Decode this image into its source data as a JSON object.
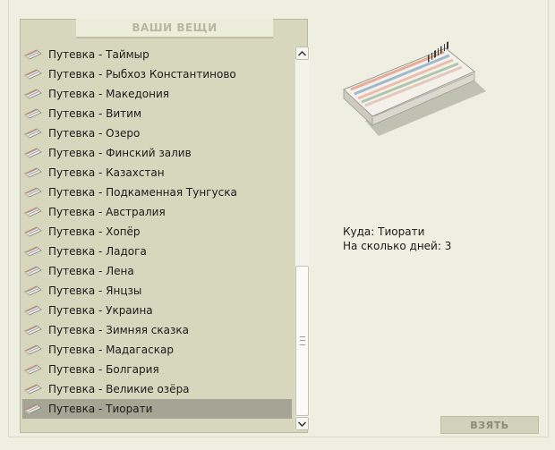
{
  "panel": {
    "title": "ВАШИ ВЕЩИ",
    "items": [
      {
        "label": "Путевка - Таймыр",
        "icon": "ticket-icon"
      },
      {
        "label": "Путевка - Рыбхоз Константиново",
        "icon": "ticket-icon"
      },
      {
        "label": "Путевка - Македония",
        "icon": "ticket-icon"
      },
      {
        "label": "Путевка - Витим",
        "icon": "ticket-icon"
      },
      {
        "label": "Путевка - Озеро",
        "icon": "ticket-icon"
      },
      {
        "label": "Путевка - Финский залив",
        "icon": "ticket-icon"
      },
      {
        "label": "Путевка - Казахстан",
        "icon": "ticket-icon"
      },
      {
        "label": "Путевка - Подкаменная Тунгуска",
        "icon": "ticket-icon"
      },
      {
        "label": "Путевка - Австралия",
        "icon": "ticket-icon"
      },
      {
        "label": "Путевка - Хопёр",
        "icon": "ticket-icon"
      },
      {
        "label": "Путевка - Ладога",
        "icon": "ticket-icon"
      },
      {
        "label": "Путевка - Лена",
        "icon": "ticket-icon"
      },
      {
        "label": "Путевка - Янцзы",
        "icon": "ticket-icon"
      },
      {
        "label": "Путевка - Украина",
        "icon": "ticket-icon"
      },
      {
        "label": "Путевка - Зимняя сказка",
        "icon": "ticket-icon"
      },
      {
        "label": "Путевка - Мадагаскар",
        "icon": "ticket-icon"
      },
      {
        "label": "Путевка - Болгария",
        "icon": "ticket-icon"
      },
      {
        "label": "Путевка - Великие озёра",
        "icon": "ticket-icon"
      },
      {
        "label": "Путевка - Тиорати",
        "icon": "ticket-icon",
        "selected": true
      }
    ]
  },
  "details": {
    "destination_label": "Куда:",
    "destination_value": "Тиорати",
    "days_label": "На сколько дней:",
    "days_value": "3"
  },
  "actions": {
    "take_label": "ВЗЯТЬ"
  },
  "colors": {
    "panel_bg": "#d7d7bd",
    "selected_bg": "#a5a596",
    "page_bg": "#efefe1"
  }
}
